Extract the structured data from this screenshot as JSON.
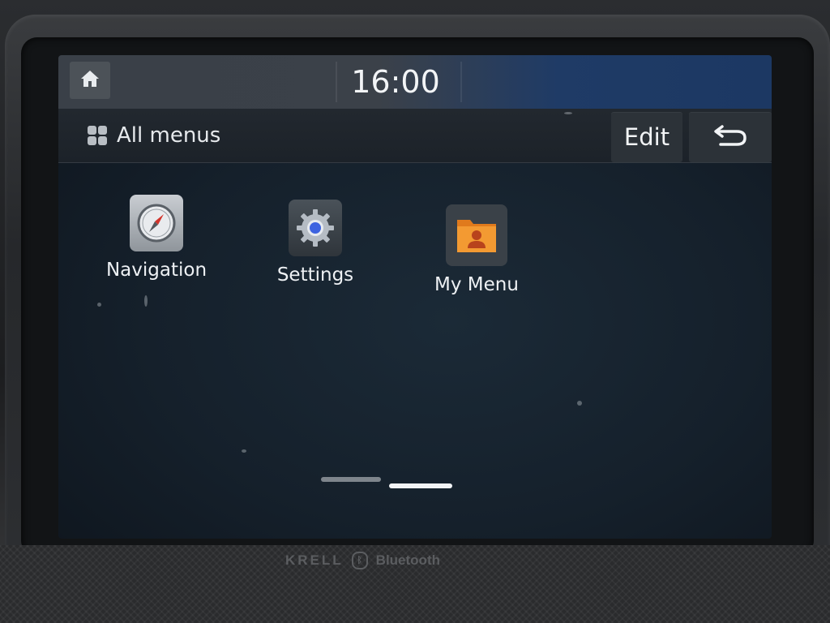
{
  "status_bar": {
    "clock": "16:00",
    "home_icon": "home-icon"
  },
  "header": {
    "title": "All menus",
    "title_icon": "grid-icon",
    "edit_label": "Edit",
    "back_icon": "back-arrow-icon"
  },
  "apps": [
    {
      "label": "Navigation",
      "icon": "compass-icon"
    },
    {
      "label": "Settings",
      "icon": "gear-icon"
    },
    {
      "label": "My Menu",
      "icon": "folder-user-icon"
    }
  ],
  "pagination": {
    "pages": 2,
    "current": 2
  },
  "hardware": {
    "brand": "KRELL",
    "bluetooth_label": "Bluetooth"
  },
  "colors": {
    "screen_bg": "#15202b",
    "status_accent": "#1c3863",
    "my_menu_orange": "#f08a24"
  }
}
